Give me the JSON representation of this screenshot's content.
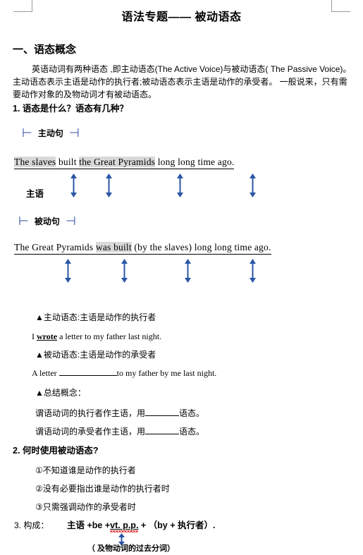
{
  "document": {
    "title": "语法专题—— 被动语态",
    "section1": {
      "heading": "一、语态概念",
      "paragraph_line1": "英语动词有两种语态 ,即主动语态(The Active Voice)与被动语态( The Passive Voice)。",
      "paragraph_line2": "主动语态表示主语是动作的执行者;被动语态表示主语是动作的承受者。 一般说来，只有需",
      "paragraph_line3": "要动作对象的及物动词才有被动语态。",
      "question1": "1. 语态是什么？语态有几种？"
    },
    "active_diagram": {
      "label": "主动句",
      "sentence_parts": {
        "subject": "The slaves",
        "verb": "built",
        "object": "the Great Pyramids",
        "adverbial": "long long time ago",
        "period": "."
      },
      "annotation": "主语"
    },
    "passive_diagram": {
      "label": "被动句",
      "sentence_parts": {
        "subject": "The Great Pyramids",
        "verb": "was built",
        "agent": "(by the slaves)",
        "adverbial": "long long time ago."
      }
    },
    "concept_notes": {
      "bullet_active": "▲主动语态:主语是动作的执行者",
      "example_active_pre": "I ",
      "example_active_verb": "wrote",
      "example_active_post": " a letter to my father last night.",
      "bullet_passive": "▲被动语态:主语是动作的承受者",
      "example_passive_pre": "A letter ",
      "example_passive_post": "to my father by me last night.",
      "bullet_summary": "▲总结概念：",
      "summary_line1_pre": "谓语动词的执行者作主语，用",
      "summary_line1_post": "语态。",
      "summary_line2_pre": "谓语动词的承受者作主语，用",
      "summary_line2_post": "语态。"
    },
    "section2": {
      "heading": "2. 何时使用被动语态?",
      "item1": "①不知道谁是动作的执行者",
      "item2": "②没有必要指出谁是动作的执行者时",
      "item3": "③只需强调动作的承受者时"
    },
    "section3": {
      "heading": "3. 构成：",
      "formula_part1": "主语 +be +",
      "formula_part2": "vt. p.p.",
      "formula_part3": " + （by + 执行者）.",
      "footnote": "（ 及物动词的过去分词）"
    }
  },
  "colors": {
    "arrow_blue": "#2a55a5",
    "bracket_blue": "#2f4fa0",
    "highlight_gray": "#d9d9d9",
    "crop_mark_gray": "#9a9a9a",
    "spellcheck_red": "#e03030"
  }
}
